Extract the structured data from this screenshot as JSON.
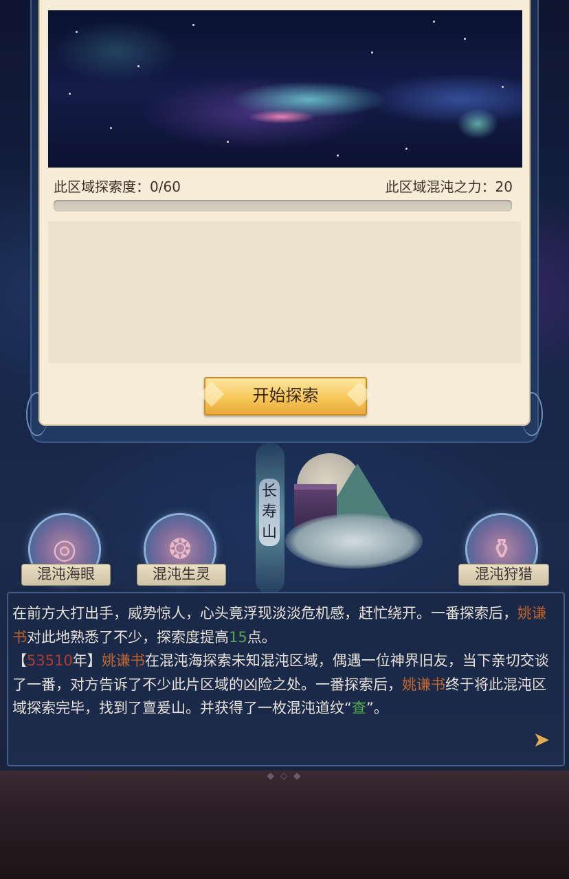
{
  "panel": {
    "explore_label": "此区域探索度：",
    "explore_value": "0/60",
    "chaos_label": "此区域混沌之力：",
    "chaos_value": "20",
    "progress": 0,
    "start_button": "开始探索"
  },
  "location": {
    "name": "长寿山"
  },
  "buttons": [
    {
      "label": "混沌海眼",
      "icon": "vortex-icon"
    },
    {
      "label": "混沌生灵",
      "icon": "creature-icon"
    },
    {
      "label": "混沌狩猎",
      "icon": "hunt-icon"
    }
  ],
  "log": {
    "line1_a": "在前方大打出手，威势惊人，心头竟浮现淡淡危机感，赶忙绕开。一番探索后，",
    "name": "姚谦书",
    "line1_b": "对此地熟悉了不少，探索度提高",
    "gain": "15",
    "line1_c": "点。",
    "bracket_open": "【",
    "year": "53510",
    "year_suffix": "年】",
    "line2_a": "在混沌海探索未知混沌区域，偶遇一位神界旧友，当下亲切交谈了一番，对方告诉了不少此片区域的凶险之处。一番探索后，",
    "line2_b": "终于将此混沌区域探索完毕，找到了亶爰山。并获得了一枚混沌道纹",
    "item_open": "“",
    "item": "查",
    "item_close": "”",
    "line2_c": "。"
  },
  "colors": {
    "name": "#c0652f",
    "gain": "#5ba34a",
    "year": "#b33a2c",
    "item": "#57b04e",
    "button_gold": "#f7c85a"
  }
}
